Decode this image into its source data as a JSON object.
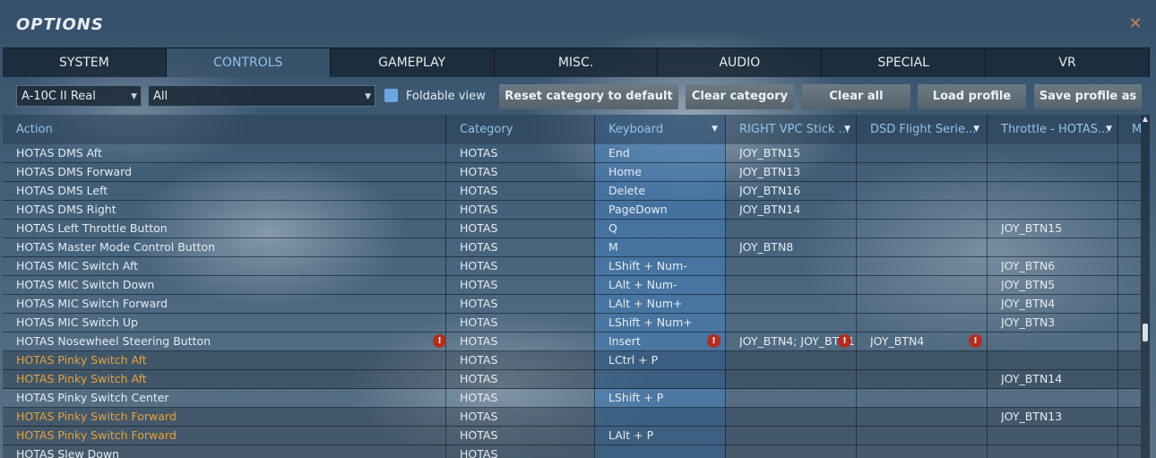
{
  "window": {
    "title": "OPTIONS",
    "close_glyph": "✕"
  },
  "tabs": [
    {
      "label": "SYSTEM",
      "active": false
    },
    {
      "label": "CONTROLS",
      "active": true
    },
    {
      "label": "GAMEPLAY",
      "active": false
    },
    {
      "label": "MISC.",
      "active": false
    },
    {
      "label": "AUDIO",
      "active": false
    },
    {
      "label": "SPECIAL",
      "active": false
    },
    {
      "label": "VR",
      "active": false
    }
  ],
  "toolbar": {
    "aircraft_select": "A-10C II Real",
    "category_select": "All",
    "foldable_label": "Foldable view",
    "foldable_checked": true,
    "reset_category": "Reset category to default",
    "clear_category": "Clear category",
    "clear_all": "Clear all",
    "load_profile": "Load profile",
    "save_profile_as": "Save profile as"
  },
  "table": {
    "headers": [
      "Action",
      "Category",
      "Keyboard",
      "RIGHT VPC Stick ...",
      "DSD Flight Serie...",
      "Throttle - HOTAS...",
      "M"
    ],
    "rows": [
      {
        "action": "HOTAS DMS Aft",
        "category": "HOTAS",
        "keyboard": "End",
        "stick": "JOY_BTN15",
        "dsd": "",
        "throttle": ""
      },
      {
        "action": "HOTAS DMS Forward",
        "category": "HOTAS",
        "keyboard": "Home",
        "stick": "JOY_BTN13",
        "dsd": "",
        "throttle": ""
      },
      {
        "action": "HOTAS DMS Left",
        "category": "HOTAS",
        "keyboard": "Delete",
        "stick": "JOY_BTN16",
        "dsd": "",
        "throttle": ""
      },
      {
        "action": "HOTAS DMS Right",
        "category": "HOTAS",
        "keyboard": "PageDown",
        "stick": "JOY_BTN14",
        "dsd": "",
        "throttle": ""
      },
      {
        "action": "HOTAS Left Throttle Button",
        "category": "HOTAS",
        "keyboard": "Q",
        "stick": "",
        "dsd": "",
        "throttle": "JOY_BTN15"
      },
      {
        "action": "HOTAS Master Mode Control Button",
        "category": "HOTAS",
        "keyboard": "M",
        "stick": "JOY_BTN8",
        "dsd": "",
        "throttle": ""
      },
      {
        "action": "HOTAS MIC Switch Aft",
        "category": "HOTAS",
        "keyboard": "LShift + Num-",
        "stick": "",
        "dsd": "",
        "throttle": "JOY_BTN6"
      },
      {
        "action": "HOTAS MIC Switch Down",
        "category": "HOTAS",
        "keyboard": "LAlt + Num-",
        "stick": "",
        "dsd": "",
        "throttle": "JOY_BTN5"
      },
      {
        "action": "HOTAS MIC Switch Forward",
        "category": "HOTAS",
        "keyboard": "LAlt + Num+",
        "stick": "",
        "dsd": "",
        "throttle": "JOY_BTN4"
      },
      {
        "action": "HOTAS MIC Switch Up",
        "category": "HOTAS",
        "keyboard": "LShift + Num+",
        "stick": "",
        "dsd": "",
        "throttle": "JOY_BTN3"
      },
      {
        "action": "HOTAS Nosewheel Steering Button",
        "category": "HOTAS",
        "keyboard": "Insert",
        "stick": "JOY_BTN4; JOY_BTN18",
        "dsd": "JOY_BTN4",
        "throttle": "",
        "warn": true
      },
      {
        "action": "HOTAS Pinky Switch Aft",
        "category": "HOTAS",
        "keyboard": "LCtrl + P",
        "stick": "",
        "dsd": "",
        "throttle": "",
        "orange": true
      },
      {
        "action": "HOTAS Pinky Switch Aft",
        "category": "HOTAS",
        "keyboard": "",
        "stick": "",
        "dsd": "",
        "throttle": "JOY_BTN14",
        "orange": true
      },
      {
        "action": "HOTAS Pinky Switch Center",
        "category": "HOTAS",
        "keyboard": "LShift + P",
        "stick": "",
        "dsd": "",
        "throttle": ""
      },
      {
        "action": "HOTAS Pinky Switch Forward",
        "category": "HOTAS",
        "keyboard": "",
        "stick": "",
        "dsd": "",
        "throttle": "JOY_BTN13",
        "orange": true
      },
      {
        "action": "HOTAS Pinky Switch Forward",
        "category": "HOTAS",
        "keyboard": "LAlt + P",
        "stick": "",
        "dsd": "",
        "throttle": "",
        "orange": true
      },
      {
        "action": "HOTAS Slew Down",
        "category": "HOTAS",
        "keyboard": "",
        "stick": "",
        "dsd": "",
        "throttle": ""
      }
    ]
  },
  "colors": {
    "accent": "#8fc3ec",
    "conflict_text": "#e5a13c",
    "warning": "#b42c1c",
    "keyboard_column": "#4682be"
  },
  "icons": {
    "warning": "exclamation-icon",
    "close": "close-icon",
    "dropdown": "chevron-down-icon"
  }
}
